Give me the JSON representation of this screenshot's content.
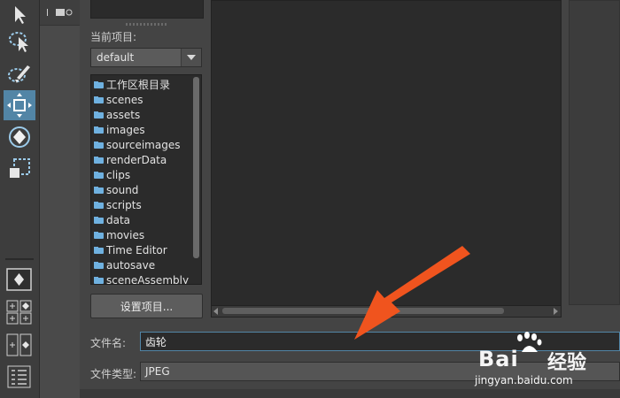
{
  "toolbar": {
    "tools": [
      {
        "name": "select-tool",
        "icon": "arrow-cursor-icon",
        "active": false
      },
      {
        "name": "lasso-tool",
        "icon": "lasso-icon",
        "active": false
      },
      {
        "name": "paint-select-tool",
        "icon": "brush-icon",
        "active": false
      },
      {
        "name": "move-tool",
        "icon": "move-arrows-icon",
        "active": true
      },
      {
        "name": "rotate-tool",
        "icon": "rotate-icon",
        "active": false
      },
      {
        "name": "scale-tool",
        "icon": "scale-icon",
        "active": false
      }
    ],
    "layouts": [
      "single-pane-icon",
      "four-pane-icon",
      "two-pane-icon",
      "outliner-icon"
    ]
  },
  "dialog": {
    "project_label": "当前项目:",
    "project_value": "default",
    "folders": [
      "工作区根目录",
      "scenes",
      "assets",
      "images",
      "sourceimages",
      "renderData",
      "clips",
      "sound",
      "scripts",
      "data",
      "movies",
      "Time Editor",
      "autosave",
      "sceneAssembly"
    ],
    "set_project_label": "设置项目...",
    "filename_label": "文件名:",
    "filename_value": "齿轮",
    "filetype_label": "文件类型:",
    "filetype_value": "JPEG"
  },
  "watermark": {
    "brand": "Bai",
    "jingyan": "经验",
    "url": "jingyan.baidu.com"
  },
  "colors": {
    "accent": "#5285a6",
    "annotation_arrow": "#f0541e",
    "folder": "#6fb1e0"
  }
}
